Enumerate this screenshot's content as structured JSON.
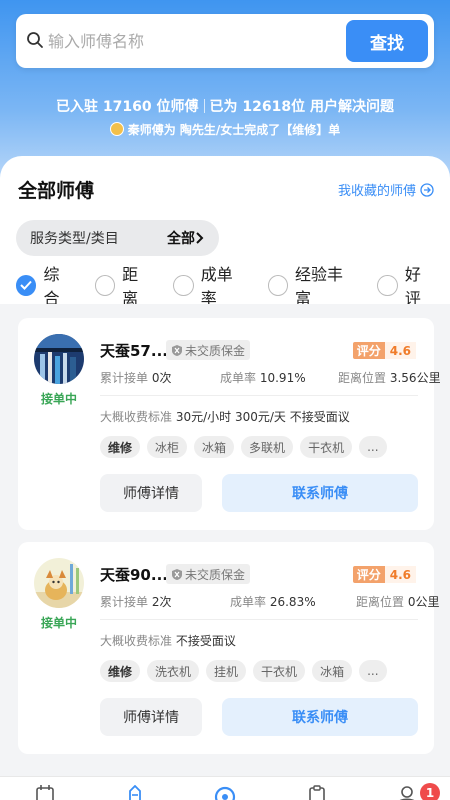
{
  "search": {
    "placeholder": "输入师傅名称",
    "button_label": "查找"
  },
  "stats": {
    "part1": "已入驻 17160 位师傅",
    "part2": "已为 12618位 用户解决问题",
    "ticker": "秦师傅为 陶先生/女士完成了【维修】单"
  },
  "section": {
    "title": "全部师傅",
    "favorites_link": "我收藏的师傅"
  },
  "category_filter": {
    "label": "服务类型/类目",
    "value": "全部"
  },
  "sort_options": [
    {
      "label": "综合",
      "checked": true
    },
    {
      "label": "距离",
      "checked": false
    },
    {
      "label": "成单率",
      "checked": false
    },
    {
      "label": "经验丰富",
      "checked": false
    },
    {
      "label": "好评",
      "checked": false
    }
  ],
  "cards": [
    {
      "name": "天蚕57...",
      "deposit": "未交质保金",
      "rating_label": "评分",
      "rating": "4.6",
      "status": "接单中",
      "orders_label": "累计接单",
      "orders": "0次",
      "rate_label": "成单率",
      "rate": "10.91%",
      "distance_label": "距离位置",
      "distance": "3.56公里",
      "fee_label": "大概收费标准",
      "fee": "30元/小时  300元/天  不接受面议",
      "tags": [
        "维修",
        "冰柜",
        "冰箱",
        "多联机",
        "干衣机",
        "..."
      ],
      "detail_button": "师傅详情",
      "contact_button": "联系师傅"
    },
    {
      "name": "天蚕90...",
      "deposit": "未交质保金",
      "rating_label": "评分",
      "rating": "4.6",
      "status": "接单中",
      "orders_label": "累计接单",
      "orders": "2次",
      "rate_label": "成单率",
      "rate": "26.83%",
      "distance_label": "距离位置",
      "distance": "0公里",
      "fee_label": "大概收费标准",
      "fee": "不接受面议",
      "tags": [
        "维修",
        "洗衣机",
        "挂机",
        "干衣机",
        "冰箱",
        "..."
      ],
      "detail_button": "师傅详情",
      "contact_button": "联系师傅"
    }
  ],
  "tabbar": {
    "badge_count": "1"
  },
  "colors": {
    "accent": "#3a8ef6",
    "status_green": "#3aa657",
    "rating_orange": "#f07c2a"
  }
}
